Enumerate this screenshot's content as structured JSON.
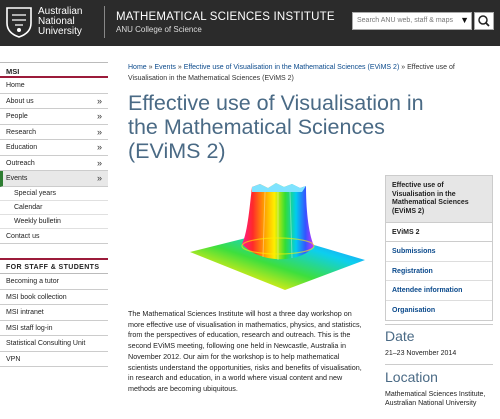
{
  "header": {
    "logo_lines": [
      "Australian",
      "National",
      "University"
    ],
    "site_title": "MATHEMATICAL SCIENCES INSTITUTE",
    "site_subtitle": "ANU College of Science",
    "search_placeholder": "Search ANU web, staff & maps"
  },
  "sidebar": {
    "heading": "MSI",
    "items": [
      {
        "label": "Home",
        "chevron": ""
      },
      {
        "label": "About us",
        "chevron": "»"
      },
      {
        "label": "People",
        "chevron": "»"
      },
      {
        "label": "Research",
        "chevron": "»"
      },
      {
        "label": "Education",
        "chevron": "»"
      },
      {
        "label": "Outreach",
        "chevron": "»"
      },
      {
        "label": "Events",
        "chevron": "»"
      }
    ],
    "event_subitems": [
      "Special years",
      "Calendar",
      "Weekly bulletin"
    ],
    "contact": "Contact us",
    "staff_heading": "FOR STAFF & STUDENTS",
    "staff_items": [
      "Becoming a tutor",
      "MSI book collection",
      "MSI intranet",
      "MSI staff log-in",
      "Statistical Consulting Unit",
      "VPN"
    ]
  },
  "breadcrumb": {
    "home": "Home",
    "sep": "»",
    "events": "Events",
    "page_link": "Effective use of Visualisation in the Mathematical Sciences (EViMS 2)",
    "current": "Effective use of Visualisation in the Mathematical Sciences (EViMS 2)"
  },
  "page": {
    "title": "Effective use of Visualisation in the Mathematical Sciences (EViMS 2)",
    "body": "The Mathematical Sciences Institute will host a three day workshop on more effective use of visualisation in mathematics, physics, and statistics, from the perspectives of education, research and outreach. This is the second EViMS meeting, following one held in Newcastle, Australia in November 2012. Our aim for the workshop is to help mathematical scientists understand the opportunities, risks and benefits of visualisation, in research and education, in a world where visual content and new methods are becoming ubiquitous."
  },
  "rightbox": {
    "title": "Effective use of Visualisation in the Mathematical Sciences (EViMS 2)",
    "current": "EViMS 2",
    "links": [
      "Submissions",
      "Registration",
      "Attendee information",
      "Organisation"
    ]
  },
  "date": {
    "heading": "Date",
    "value": "21–23 November 2014"
  },
  "location": {
    "heading": "Location",
    "value": "Mathematical Sciences Institute, Australian National University"
  }
}
